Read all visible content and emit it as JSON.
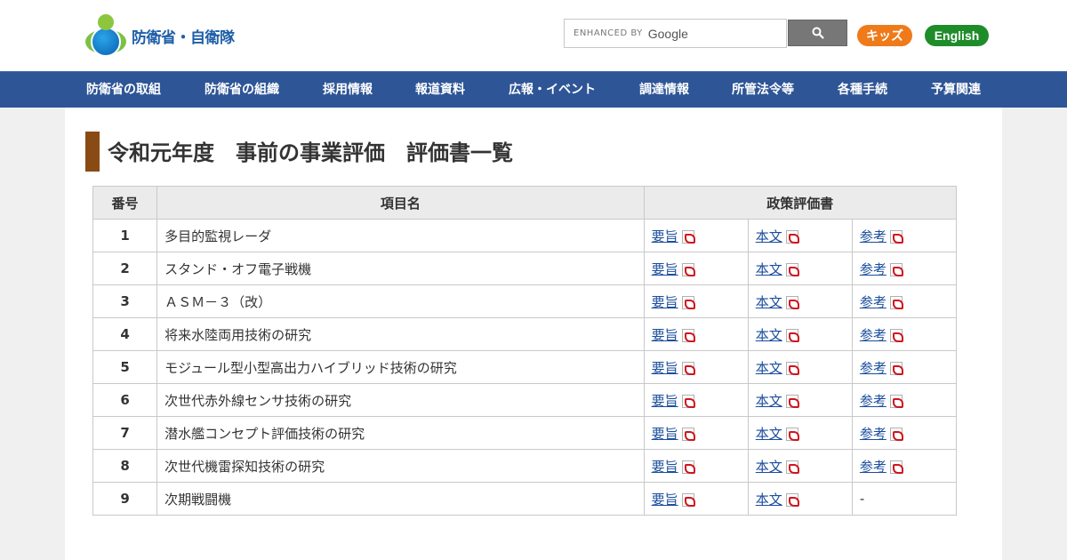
{
  "header": {
    "logo_text": "防衛省・自衛隊",
    "search_placeholder_prefix": "ENHANCED BY",
    "search_placeholder_brand": "Google",
    "kids_label": "キッズ",
    "english_label": "English"
  },
  "nav": {
    "items": [
      {
        "label": "防衛省の取組"
      },
      {
        "label": "防衛省の組織"
      },
      {
        "label": "採用情報"
      },
      {
        "label": "報道資料"
      },
      {
        "label": "広報・イベント"
      },
      {
        "label": "調達情報"
      },
      {
        "label": "所管法令等"
      },
      {
        "label": "各種手続"
      },
      {
        "label": "予算関連"
      }
    ]
  },
  "main": {
    "title": "令和元年度　事前の事業評価　評価書一覧",
    "table": {
      "headers": {
        "num": "番号",
        "name": "項目名",
        "docs": "政策評価書"
      },
      "rows": [
        {
          "num": "1",
          "name": "多目的監視レーダ",
          "doc1": "要旨",
          "doc2": "本文",
          "doc3": "参考"
        },
        {
          "num": "2",
          "name": "スタンド・オフ電子戦機",
          "doc1": "要旨",
          "doc2": "本文",
          "doc3": "参考"
        },
        {
          "num": "3",
          "name": "ＡＳＭ－３（改）",
          "doc1": "要旨",
          "doc2": "本文",
          "doc3": "参考"
        },
        {
          "num": "4",
          "name": "将来水陸両用技術の研究",
          "doc1": "要旨",
          "doc2": "本文",
          "doc3": "参考"
        },
        {
          "num": "5",
          "name": "モジュール型小型高出力ハイブリッド技術の研究",
          "doc1": "要旨",
          "doc2": "本文",
          "doc3": "参考"
        },
        {
          "num": "6",
          "name": "次世代赤外線センサ技術の研究",
          "doc1": "要旨",
          "doc2": "本文",
          "doc3": "参考"
        },
        {
          "num": "7",
          "name": "潜水艦コンセプト評価技術の研究",
          "doc1": "要旨",
          "doc2": "本文",
          "doc3": "参考"
        },
        {
          "num": "8",
          "name": "次世代機雷探知技術の研究",
          "doc1": "要旨",
          "doc2": "本文",
          "doc3": "参考"
        },
        {
          "num": "9",
          "name": "次期戦闘機",
          "doc1": "要旨",
          "doc2": "本文",
          "doc3": "-"
        }
      ]
    }
  },
  "icons": {
    "search": "search-icon",
    "pdf": "pdf-icon"
  }
}
